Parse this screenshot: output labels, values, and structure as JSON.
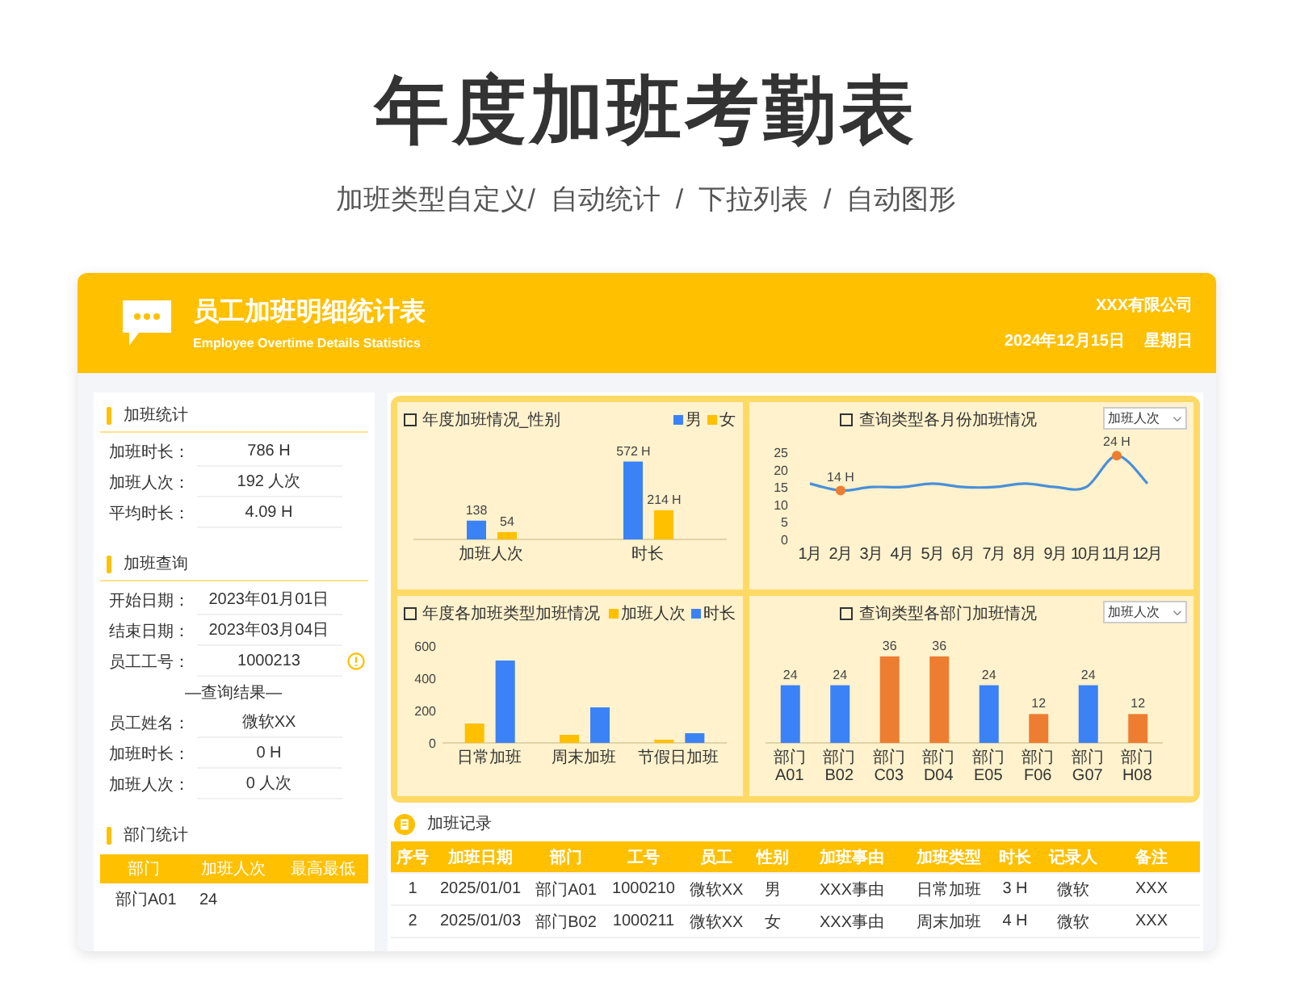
{
  "title": "年度加班考勤表",
  "subtitle": "加班类型自定义/  自动统计  /  下拉列表  /  自动图形",
  "header": {
    "title": "员工加班明细统计表",
    "subtitle": "Employee Overtime Details Statistics",
    "company": "XXX有限公司",
    "date": "2024年12月15日",
    "weekday": "星期日"
  },
  "overtime_stats": {
    "title": "加班统计",
    "rows": [
      {
        "label": "加班时长：",
        "value": "786 H"
      },
      {
        "label": "加班人次：",
        "value": "192 人次"
      },
      {
        "label": "平均时长：",
        "value": "4.09 H"
      }
    ]
  },
  "overtime_query": {
    "title": "加班查询",
    "rows": [
      {
        "label": "开始日期：",
        "value": "2023年01月01日",
        "info": false
      },
      {
        "label": "结束日期：",
        "value": "2023年03月04日",
        "info": false
      },
      {
        "label": "员工工号：",
        "value": "1000213",
        "info": true
      }
    ],
    "result_heading": "—查询结果—",
    "result_rows": [
      {
        "label": "员工姓名：",
        "value": "微软XX"
      },
      {
        "label": "加班时长：",
        "value": "0 H"
      },
      {
        "label": "加班人次：",
        "value": "0 人次"
      }
    ]
  },
  "dept_stats": {
    "title": "部门统计",
    "columns": [
      "部门",
      "加班人次",
      "最高最低"
    ],
    "rows": [
      [
        "部门A01",
        "24"
      ]
    ]
  },
  "charts": [
    {
      "title": "年度加班情况_性别",
      "chart_data": {
        "type": "bar",
        "categories": [
          "加班人次",
          "时长"
        ],
        "series": [
          {
            "name": "男",
            "color": "#3b82f6",
            "values": [
              138,
              572
            ]
          },
          {
            "name": "女",
            "color": "#ffc000",
            "values": [
              54,
              214
            ]
          }
        ],
        "data_labels": true
      },
      "last_category_units": [
        "H",
        "H"
      ]
    },
    {
      "title": "查询类型各月份加班情况",
      "dropdown": "加班人次",
      "chart_data": {
        "type": "line",
        "x": [
          "1月",
          "2月",
          "3月",
          "4月",
          "5月",
          "6月",
          "7月",
          "8月",
          "9月",
          "10月",
          "11月",
          "12月"
        ],
        "ylim": [
          0,
          25
        ],
        "yticks": [
          0,
          5,
          10,
          15,
          20,
          25
        ],
        "series": [
          {
            "color": "#4a8fd9",
            "values": [
              16,
              14,
              15,
              15,
              16,
              15,
              15,
              16,
              15,
              15,
              24,
              16
            ]
          }
        ],
        "value_labels": [
          [
            null,
            "14 H",
            null,
            null,
            null,
            null,
            null,
            null,
            null,
            null,
            "24 H",
            null
          ]
        ]
      }
    },
    {
      "title": "年度各加班类型加班情况",
      "chart_data": {
        "type": "bar",
        "categories": [
          "日常加班",
          "周末加班",
          "节假日加班"
        ],
        "ylim": [
          0,
          600
        ],
        "yticks": [
          0,
          200,
          400,
          600
        ],
        "series": [
          {
            "name": "加班人次",
            "color": "#ffc000",
            "values": [
              120,
              50,
              20
            ]
          },
          {
            "name": "时长",
            "color": "#3b82f6",
            "values": [
              510,
              220,
              60
            ]
          }
        ]
      }
    },
    {
      "title": "查询类型各部门加班情况",
      "dropdown": "加班人次",
      "chart_data": {
        "type": "bar",
        "categories": [
          "部门A01",
          "部门B02",
          "部门C03",
          "部门D04",
          "部门E05",
          "部门F06",
          "部门G07",
          "部门H08"
        ],
        "series": [
          {
            "color": "#3b82f6",
            "values": [
              24,
              24,
              null,
              null,
              24,
              null,
              24,
              null
            ]
          },
          {
            "color": "#ed7d31",
            "values": [
              null,
              null,
              36,
              36,
              null,
              12,
              null,
              12
            ]
          }
        ],
        "data_labels": true
      }
    }
  ],
  "records": {
    "title": "加班记录",
    "columns": [
      "序号",
      "加班日期",
      "部门",
      "工号",
      "员工",
      "性别",
      "加班事由",
      "加班类型",
      "时长",
      "记录人",
      "备注"
    ],
    "rows": [
      [
        "1",
        "2025/01/01",
        "部门A01",
        "1000210",
        "微软XX",
        "男",
        "XXX事由",
        "日常加班",
        "3 H",
        "微软",
        "XXX"
      ],
      [
        "2",
        "2025/01/03",
        "部门B02",
        "1000211",
        "微软XX",
        "女",
        "XXX事由",
        "周末加班",
        "4 H",
        "微软",
        "XXX"
      ]
    ]
  }
}
